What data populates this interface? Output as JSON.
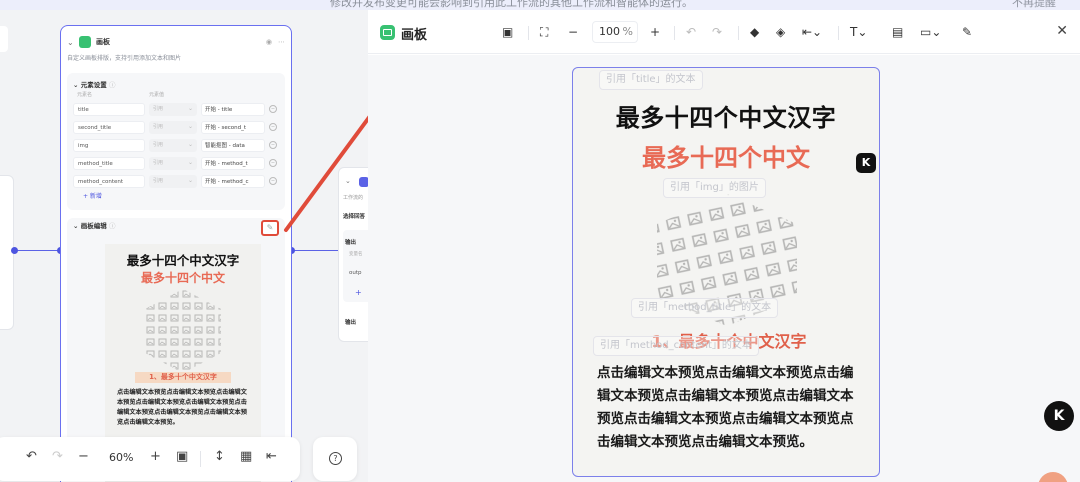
{
  "banner": {
    "message": "修改并发布变更可能会影响到引用此工作流的其他工作流和智能体的运行。",
    "remind": "不再提醒"
  },
  "node": {
    "title": "画板",
    "description": "自定义画板排版，支持引用添加文本和图片",
    "elements_section": "元素设置",
    "col_name": "元素名",
    "col_value": "元素值",
    "rows": [
      {
        "name": "title",
        "type": "引用",
        "value": "开始 - title"
      },
      {
        "name": "second_title",
        "type": "引用",
        "value": "开始 - second_t"
      },
      {
        "name": "img",
        "type": "引用",
        "value": "智能抠图 - data"
      },
      {
        "name": "method_title",
        "type": "引用",
        "value": "开始 - method_t"
      },
      {
        "name": "method_content",
        "type": "引用",
        "value": "开始 - method_c"
      }
    ],
    "add_label": "+ 新增",
    "edit_section": "画板编辑"
  },
  "right_node": {
    "desc": "工作流的",
    "label": "选择回答",
    "output": "输出",
    "var": "变量名",
    "value": "outp",
    "plus": "+",
    "output2": "输出"
  },
  "bottom_toolbar": {
    "zoom": "60%"
  },
  "editor": {
    "title": "画板",
    "zoom_value": "100",
    "zoom_unit": "%",
    "tags": {
      "title": "引用「title」的文本",
      "img": "引用「img」的图片",
      "method_title": "引用「method_title」的文本",
      "method_content": "引用「method_content」的文本"
    }
  },
  "board": {
    "title": "最多十四个中文汉字",
    "second_title": "最多十四个中文",
    "method_title": "1、最多十个中文汉字",
    "method_content": "点击编辑文本预览点击编辑文本预览点击编辑文本预览点击编辑文本预览点击编辑文本预览点击编辑文本预览点击编辑文本预览点击编辑文本预览点击编辑文本预览。"
  },
  "badges": {
    "k": "K"
  },
  "colors": {
    "accent": "#4d55e0",
    "node_border": "#6a70f0",
    "red_highlight": "#e04b3a",
    "second_title": "#e86a55",
    "green_icon": "#38c172"
  }
}
